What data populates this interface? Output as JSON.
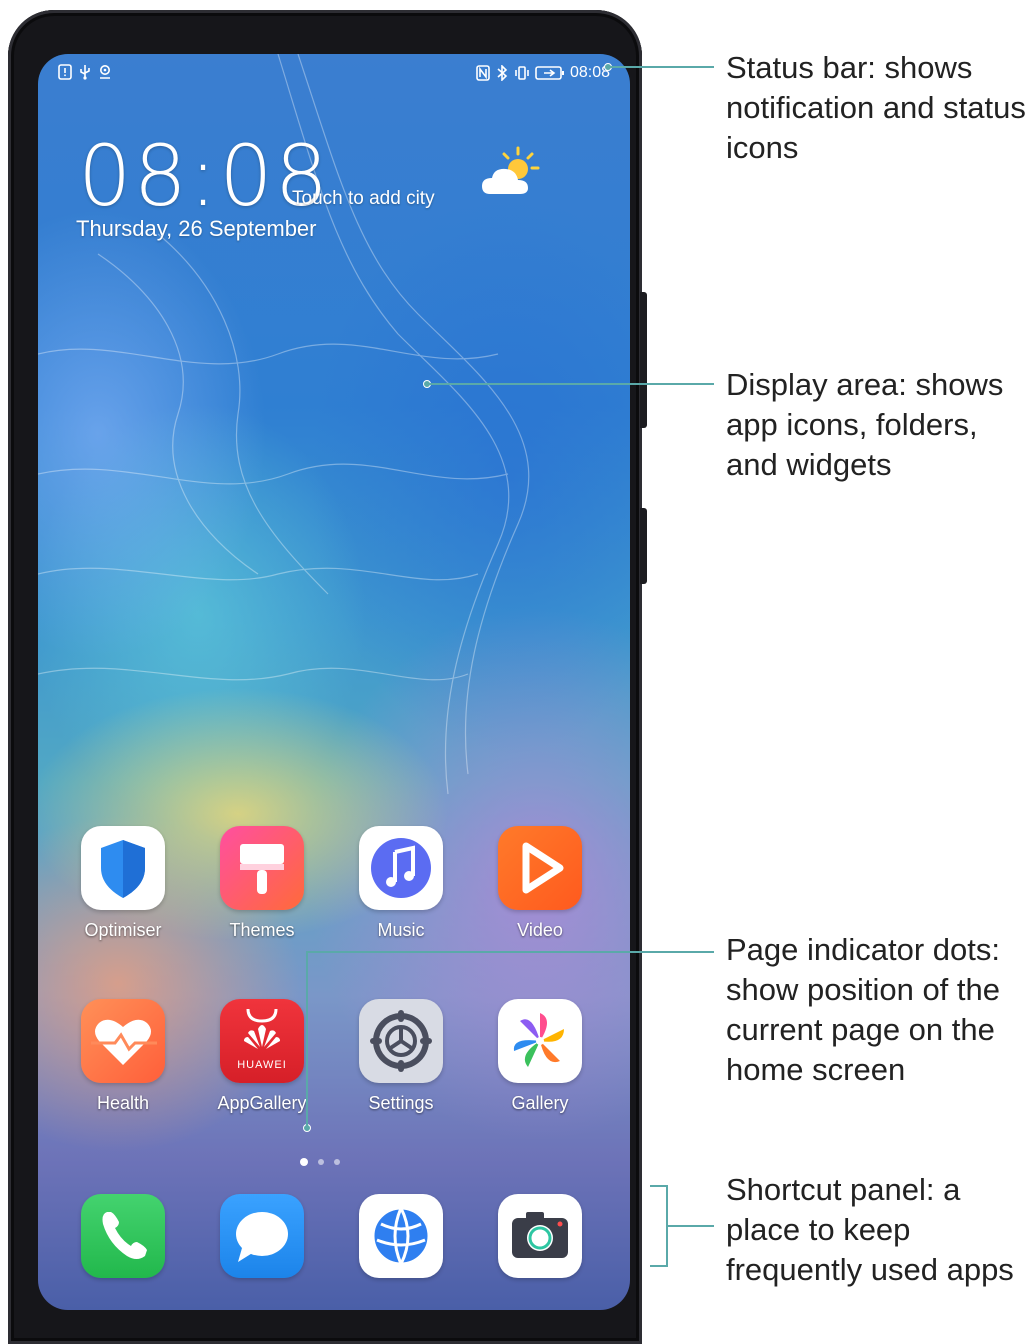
{
  "status_bar": {
    "time": "08:08",
    "left_icons": [
      "alert-icon",
      "usb-icon",
      "location-icon"
    ],
    "right_icons": [
      "nfc-icon",
      "bluetooth-icon",
      "vibrate-icon",
      "battery-icon"
    ]
  },
  "clock_widget": {
    "time": "08:08",
    "city_prompt": "Touch to add city",
    "date": "Thursday, 26 September",
    "weather_icon": "partly-sunny-icon"
  },
  "apps": [
    {
      "label": "Optimiser",
      "icon": "shield-icon"
    },
    {
      "label": "Themes",
      "icon": "paintbrush-icon"
    },
    {
      "label": "Music",
      "icon": "music-note-icon"
    },
    {
      "label": "Video",
      "icon": "play-icon"
    },
    {
      "label": "Health",
      "icon": "heart-icon"
    },
    {
      "label": "AppGallery",
      "icon": "huawei-logo-icon",
      "badge_text": "HUAWEI"
    },
    {
      "label": "Settings",
      "icon": "gear-icon"
    },
    {
      "label": "Gallery",
      "icon": "pinwheel-icon"
    }
  ],
  "page_indicator": {
    "pages": 3,
    "current": 1
  },
  "dock": [
    {
      "icon": "phone-icon"
    },
    {
      "icon": "message-icon"
    },
    {
      "icon": "browser-icon"
    },
    {
      "icon": "camera-icon"
    }
  ],
  "callouts": [
    {
      "text": "Status bar: shows notification and status icons"
    },
    {
      "text": "Display area: shows app icons, folders, and widgets"
    },
    {
      "text": "Page indicator dots: show position of the current page on the home screen"
    },
    {
      "text": "Shortcut panel: a place to keep frequently used apps"
    }
  ],
  "colors": {
    "callout_line": "#5aa9a9",
    "optimiser": "#2e8cf0",
    "themes": "#ff5a5a",
    "music": "#5b6cf2",
    "video": "#ff6a2a",
    "health": "#ff6b4a",
    "appgallery": "#e8272f",
    "phone": "#2ecc5e",
    "message": "#2a94f4"
  }
}
